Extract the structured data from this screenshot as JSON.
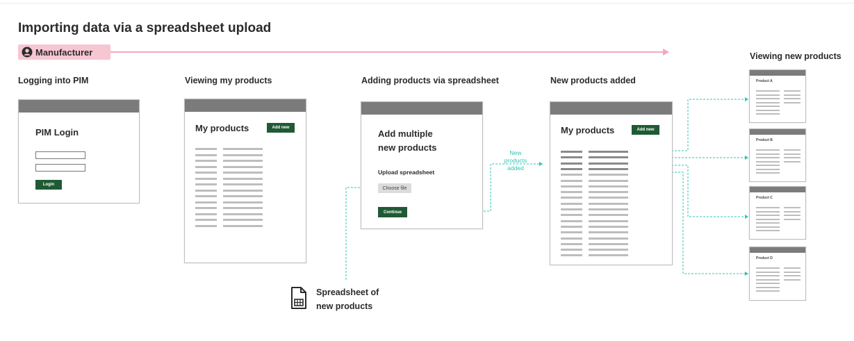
{
  "diagram": {
    "title": "Importing data via a spreadsheet upload",
    "persona": {
      "label": "Manufacturer",
      "icon": "user-circle-icon"
    },
    "colors": {
      "accent_green": "#1f5a34",
      "persona_pink": "#f7c6d3",
      "arrow_pink": "#f3a6bf",
      "teal": "#2ec4b6",
      "frame_bar": "#7b7b7b"
    },
    "steps": [
      {
        "label": "Logging into PIM"
      },
      {
        "label": "Viewing my products"
      },
      {
        "label": "Adding products via spreadsheet"
      },
      {
        "label": "New products added"
      },
      {
        "label": "Viewing new products"
      }
    ],
    "login": {
      "heading": "PIM Login",
      "button": "Login"
    },
    "products": {
      "heading": "My products",
      "button": "Add new"
    },
    "upload": {
      "heading_line1": "Add multiple",
      "heading_line2": "new products",
      "subheading": "Upload spreadsheet",
      "choose_button": "Choose file",
      "continue_button": "Continue"
    },
    "added": {
      "heading": "My products",
      "button": "Add new"
    },
    "new_products_note": {
      "line1": "New",
      "line2": "products",
      "line3": "added"
    },
    "product_cards": [
      {
        "title": "Product A"
      },
      {
        "title": "Product B"
      },
      {
        "title": "Product C"
      },
      {
        "title": "Product D"
      }
    ],
    "spreadsheet": {
      "icon": "spreadsheet-file-icon",
      "line1": "Spreadsheet of",
      "line2": "new products"
    }
  }
}
